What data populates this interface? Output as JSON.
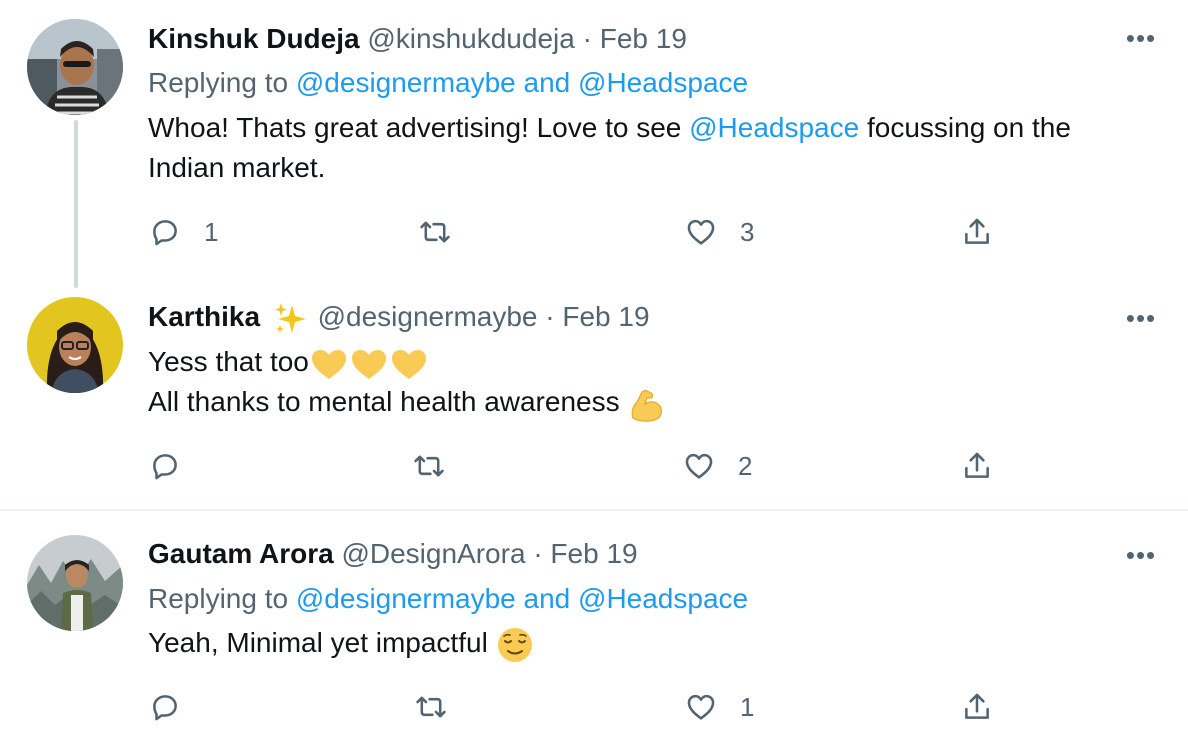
{
  "tweets": [
    {
      "name": "Kinshuk Dudeja",
      "handle": "@kinshukdudeja",
      "sep": "·",
      "date": "Feb 19",
      "replying_prefix": "Replying to",
      "replying_to": "@designermaybe and @Headspace",
      "text_a": "Whoa! Thats great advertising! Love to see",
      "mention": "@Headspace",
      "text_b": "focussing on the",
      "text_c": "Indian market.",
      "reply_count": "1",
      "retweet_count": "",
      "like_count": "3"
    },
    {
      "name": "Karthika",
      "handle": "@designermaybe",
      "sep": "·",
      "date": "Feb 19",
      "line1": "Yess that too",
      "line2": "All thanks to mental health awareness",
      "reply_count": "",
      "retweet_count": "",
      "like_count": "2"
    },
    {
      "name": "Gautam Arora",
      "handle": "@DesignArora",
      "sep": "·",
      "date": "Feb 19",
      "replying_prefix": "Replying to",
      "replying_to": "@designermaybe and @Headspace",
      "text": "Yeah, Minimal yet impactful",
      "reply_count": "",
      "retweet_count": "",
      "like_count": "1"
    }
  ],
  "more_label": "•••",
  "icons": [
    "reply-icon",
    "retweet-icon",
    "like-icon",
    "share-icon",
    "sparkles-emoji",
    "yellow-heart-emoji",
    "flexed-biceps-emoji",
    "relieved-face-emoji"
  ],
  "colors": {
    "link": "#1d9bf0",
    "meta": "#536471",
    "text": "#0f1419",
    "divider": "#eff3f4",
    "thread": "#cfd9de"
  }
}
